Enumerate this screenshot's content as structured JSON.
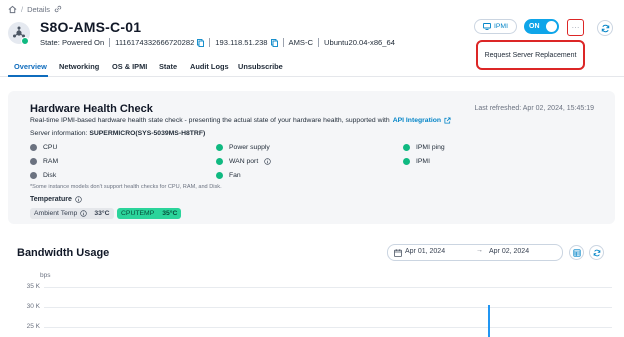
{
  "breadcrumb": {
    "current": "Details"
  },
  "server": {
    "name": "S8O-AMS-C-01",
    "state": "State: Powered On",
    "id": "1116174332666720282",
    "ip": "193.118.51.238",
    "location": "AMS-C",
    "os": "Ubuntu20.04-x86_64",
    "status_color": "#10b981"
  },
  "actions": {
    "ipmi_label": "IPMI",
    "power_label": "ON",
    "more_label": "···",
    "menu_items": [
      "Request Server Replacement"
    ]
  },
  "tabs": [
    "Overview",
    "Networking",
    "OS & IPMI",
    "State",
    "Audit Logs",
    "Unsubscribe"
  ],
  "active_tab": "Overview",
  "hardware": {
    "title": "Hardware Health Check",
    "last_refreshed": "Last refreshed: Apr 02, 2024, 15:45:19",
    "description": "Real-time IPMI-based hardware health state check - presenting the actual state of your hardware health, supported with",
    "api_link": "API Integration",
    "server_info_label": "Server information:",
    "server_info_value": "SUPERMICRO(SYS-5039MS-H8TRF)",
    "checks": [
      {
        "label": "CPU",
        "status": "grey"
      },
      {
        "label": "Power supply",
        "status": "green"
      },
      {
        "label": "IPMI ping",
        "status": "green"
      },
      {
        "label": "RAM",
        "status": "grey"
      },
      {
        "label": "WAN port",
        "status": "green"
      },
      {
        "label": "IPMI",
        "status": "green"
      },
      {
        "label": "Disk",
        "status": "grey"
      },
      {
        "label": "Fan",
        "status": "green"
      }
    ],
    "note": "*Some instance models don't support health checks for CPU, RAM, and Disk.",
    "temperature_label": "Temperature",
    "ambient_label": "Ambient Temp",
    "ambient_value": "33°C",
    "cpu_label": "CPUTEMP",
    "cpu_value": "35°C"
  },
  "bandwidth": {
    "title": "Bandwidth Usage",
    "start_date": "Apr 01, 2024",
    "end_date": "Apr 02, 2024",
    "unit": "bps",
    "ticks": [
      "35 K",
      "30 K",
      "25 K"
    ]
  },
  "colors": {
    "accent": "#0284c7",
    "tab_active": "#0f6cbd",
    "ok": "#10b981",
    "unknown": "#6b7280",
    "highlight": "#dc2626",
    "chart_line": "#2196f3"
  }
}
